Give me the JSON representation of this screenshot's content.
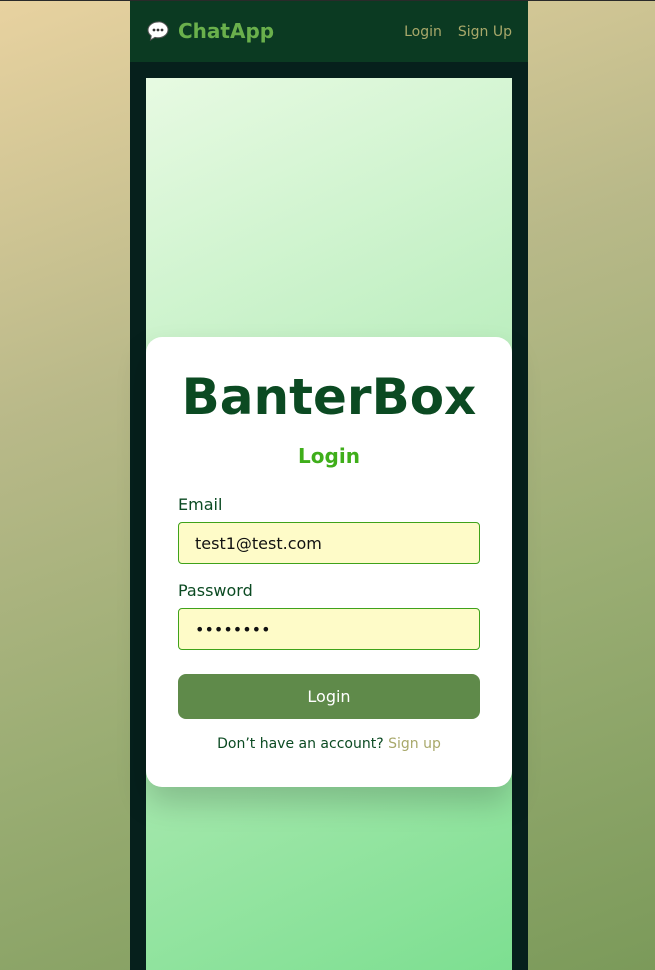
{
  "navbar": {
    "brand_icon": "chat-bubble-icon",
    "brand_name": "ChatApp",
    "links": [
      {
        "label": "Login"
      },
      {
        "label": "Sign Up"
      }
    ]
  },
  "card": {
    "app_title": "BanterBox",
    "form_title": "Login",
    "email": {
      "label": "Email",
      "value": "test1@test.com"
    },
    "password": {
      "label": "Password",
      "value": "password"
    },
    "submit_label": "Login",
    "signup_prompt": "Don’t have an account?",
    "signup_link": "Sign up"
  },
  "colors": {
    "navbar_bg": "#0b3a22",
    "brand": "#6ab04c",
    "nav_link": "#a8a86a",
    "title": "#0b4a22",
    "form_title": "#3fae1a",
    "input_bg": "#fefbc8",
    "input_border": "#3fa21a",
    "button_bg": "#5f8a4a"
  }
}
